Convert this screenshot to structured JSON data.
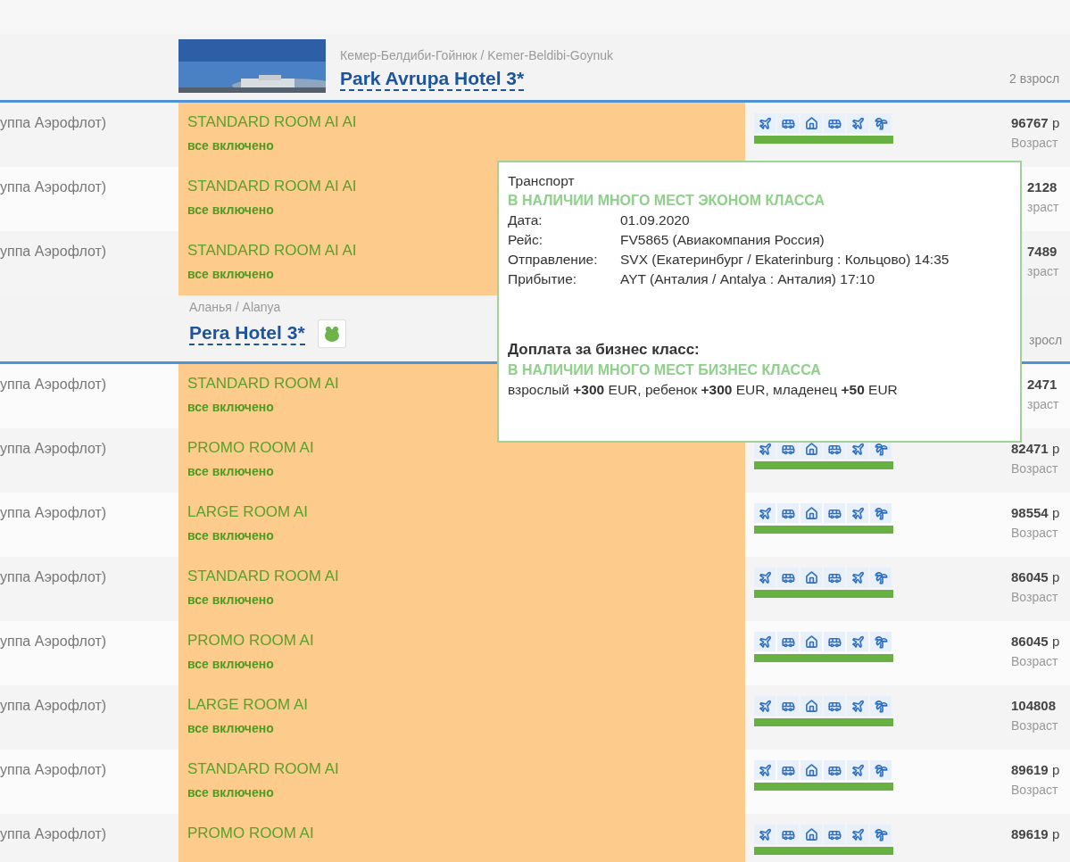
{
  "hotels": [
    {
      "location": "Кемер-Белдиби-Гойнюк / Kemer-Beldibi-Goynuk",
      "name": "Park Avrupa Hotel 3*",
      "guests": "2 взросл",
      "guests_covered": false,
      "emblem": false,
      "rooms": [
        {
          "operator": "уппа Аэрофлот)",
          "room": "STANDARD ROOM AI AI",
          "meal": "все включено",
          "icons": true,
          "price": "96767",
          "currency": "р",
          "age": "Возраст",
          "covered": false
        },
        {
          "operator": "уппа Аэрофлот)",
          "room": "STANDARD ROOM AI AI",
          "meal": "все включено",
          "icons": false,
          "price": "2128",
          "age": "зраст",
          "covered": true
        },
        {
          "operator": "уппа Аэрофлот)",
          "room": "STANDARD ROOM AI AI",
          "meal": "все включено",
          "icons": false,
          "price": "7489",
          "age": "зраст",
          "covered": true
        }
      ]
    },
    {
      "kind": "plain",
      "location": "Аланья / Alanya",
      "name": "Pera Hotel 3*",
      "guests": "зросл",
      "guests_covered": true,
      "emblem": true,
      "rooms": [
        {
          "operator": "уппа Аэрофлот)",
          "room": "STANDARD ROOM AI",
          "meal": "все включено",
          "icons": false,
          "price": "2471",
          "age": "зраст",
          "covered": true
        },
        {
          "operator": "уппа Аэрофлот)",
          "room": "PROMO ROOM AI",
          "meal": "все включено",
          "icons": true,
          "price": "82471",
          "currency": "р",
          "age": "Возраст",
          "covered": false
        },
        {
          "operator": "уппа Аэрофлот)",
          "room": "LARGE ROOM AI",
          "meal": "все включено",
          "icons": true,
          "price": "98554",
          "currency": "р",
          "age": "Возраст",
          "covered": false
        },
        {
          "operator": "уппа Аэрофлот)",
          "room": "STANDARD ROOM AI",
          "meal": "все включено",
          "icons": true,
          "price": "86045",
          "currency": "р",
          "age": "Возраст",
          "covered": false
        },
        {
          "operator": "уппа Аэрофлот)",
          "room": "PROMO ROOM AI",
          "meal": "все включено",
          "icons": true,
          "price": "86045",
          "currency": "р",
          "age": "Возраст",
          "covered": false
        },
        {
          "operator": "уппа Аэрофлот)",
          "room": "LARGE ROOM AI",
          "meal": "все включено",
          "icons": true,
          "price": "104808",
          "age": "Возраст",
          "covered": false
        },
        {
          "operator": "уппа Аэрофлот)",
          "room": "STANDARD ROOM AI",
          "meal": "все включено",
          "icons": true,
          "price": "89619",
          "currency": "р",
          "age": "Возраст",
          "covered": false
        },
        {
          "operator": "уппа Аэрофлот)",
          "room": "PROMO ROOM AI",
          "icons": true,
          "price": "89619",
          "currency": "р",
          "covered": false
        }
      ]
    }
  ],
  "tooltip": {
    "title": "Транспорт",
    "economy_status": "В НАЛИЧИИ МНОГО МЕСТ ЭКОНОМ КЛАССА",
    "details": [
      {
        "label": "Дата:",
        "value": "01.09.2020"
      },
      {
        "label": "Рейс:",
        "value": "FV5865 (Авиакомпания Россия)"
      },
      {
        "label": "Отправление:",
        "value": "SVX (Екатеринбург / Ekaterinburg : Кольцово) 14:35"
      },
      {
        "label": "Прибытие:",
        "value": "AYT (Анталия / Antalya : Анталия) 17:10"
      }
    ],
    "business_title": "Доплата за бизнес класс:",
    "business_status": "В НАЛИЧИИ МНОГО МЕСТ БИЗНЕС КЛАССА",
    "business_prices": "взрослый **+300** EUR, ребенок **+300** EUR, младенец **+50** EUR"
  }
}
